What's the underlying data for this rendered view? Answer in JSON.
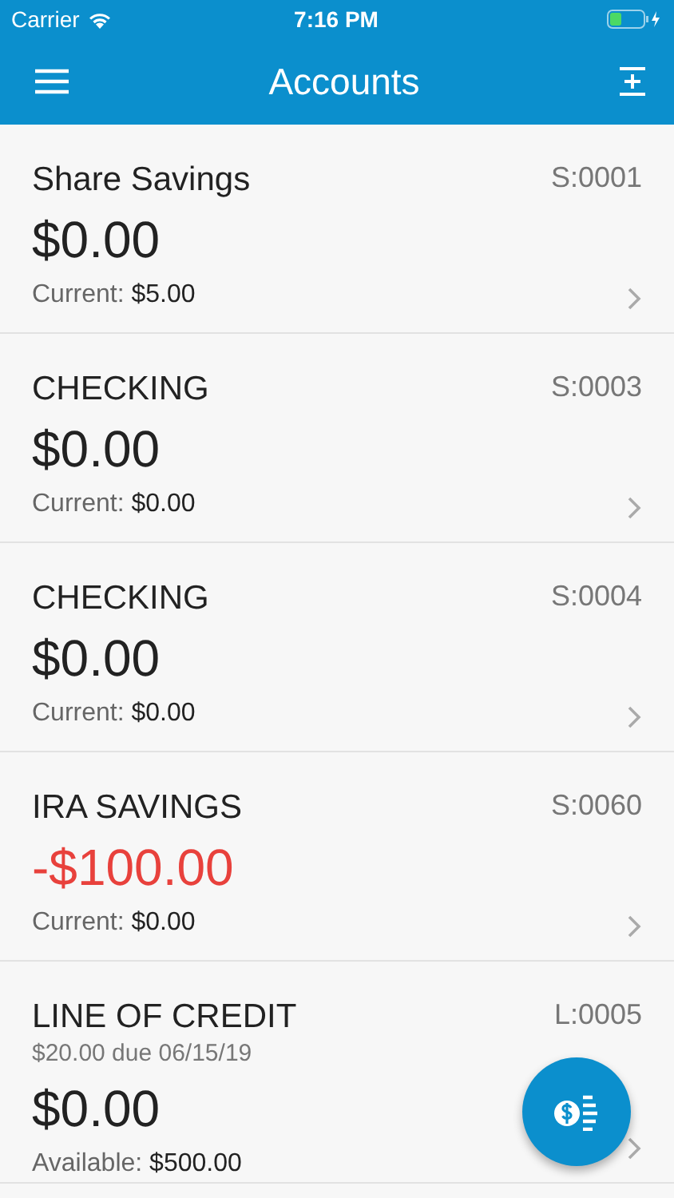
{
  "status_bar": {
    "carrier": "Carrier",
    "time": "7:16 PM"
  },
  "header": {
    "title": "Accounts"
  },
  "accounts": [
    {
      "name": "Share Savings",
      "id": "S:0001",
      "balance": "$0.00",
      "negative": false,
      "detail_label": "Current:",
      "detail_value": "$5.00"
    },
    {
      "name": "CHECKING",
      "id": "S:0003",
      "balance": "$0.00",
      "negative": false,
      "detail_label": "Current:",
      "detail_value": "$0.00"
    },
    {
      "name": "CHECKING",
      "id": "S:0004",
      "balance": "$0.00",
      "negative": false,
      "detail_label": "Current:",
      "detail_value": "$0.00"
    },
    {
      "name": "IRA SAVINGS",
      "id": "S:0060",
      "balance": "-$100.00",
      "negative": true,
      "detail_label": "Current:",
      "detail_value": "$0.00"
    },
    {
      "name": "LINE OF CREDIT",
      "id": "L:0005",
      "due": "$20.00 due 06/15/19",
      "balance": "$0.00",
      "negative": false,
      "detail_label": "Available:",
      "detail_value": "$500.00"
    }
  ]
}
